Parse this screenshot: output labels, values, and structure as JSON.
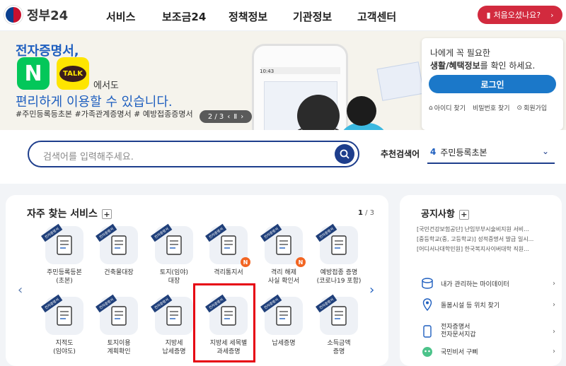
{
  "header": {
    "logo": "정부24",
    "nav": [
      "서비스",
      "보조금24",
      "정책정보",
      "기관정보",
      "고객센터"
    ],
    "first_visit": "처음오셨나요?"
  },
  "banner": {
    "line1": "전자증명서,",
    "naver": "N",
    "kakao": "TALK",
    "line2": "에서도",
    "line3": "편리하게 이용할 수 있습니다.",
    "tags": "#주민등록등초본  #가족관계증명서  # 예방접종증명서",
    "pager": "2 / 3",
    "phone_time": "10:43"
  },
  "login": {
    "line1": "나에게 꼭 필요한",
    "line2_bold": "생활/혜택정보",
    "line2_rest": "를 확인 하세요.",
    "button": "로그인",
    "find_id": "아이디 찾기",
    "find_pw": "비밀번호 찾기",
    "signup": "회원가입"
  },
  "search": {
    "placeholder": "검색어를 입력해주세요.",
    "rec_label": "추천검색어",
    "rec_num": "4",
    "rec_value": "주민등록초본"
  },
  "frequent": {
    "title": "자주 찾는 서비스",
    "page_cur": "1",
    "page_total": " / 3",
    "ribbon": "전자증명서",
    "items": [
      "주민등록등본\n(초본)",
      "건축물대장",
      "토지(임야)\n대장",
      "격리통지서",
      "격리 해제\n사실 확인서",
      "예방접종 증명\n(코로나19 포함)",
      "지적도\n(임야도)",
      "토지이용\n계획확인",
      "지방세\n납세증명",
      "지방세 세목별\n과세증명",
      "납세증명",
      "소득금액\n증명"
    ]
  },
  "notice": {
    "title": "공지사항",
    "items": [
      "[국민건강보험공단] 난임부부시술비지원 서비...",
      "[중등학교(중, 고등학교)] 성적증명서 발급 일시...",
      "[어디서나대학민원] 한국복지사이버대학 직원..."
    ],
    "quick": [
      "내가 관리하는 마이데이터",
      "돌봄시설 등 위치 찾기",
      "전자증명서\n전자문서지갑",
      "국민비서 구삐"
    ]
  },
  "colors": {
    "brand": "#1e3e8c",
    "red": "#d22a3e",
    "highlight": "#e60012"
  }
}
